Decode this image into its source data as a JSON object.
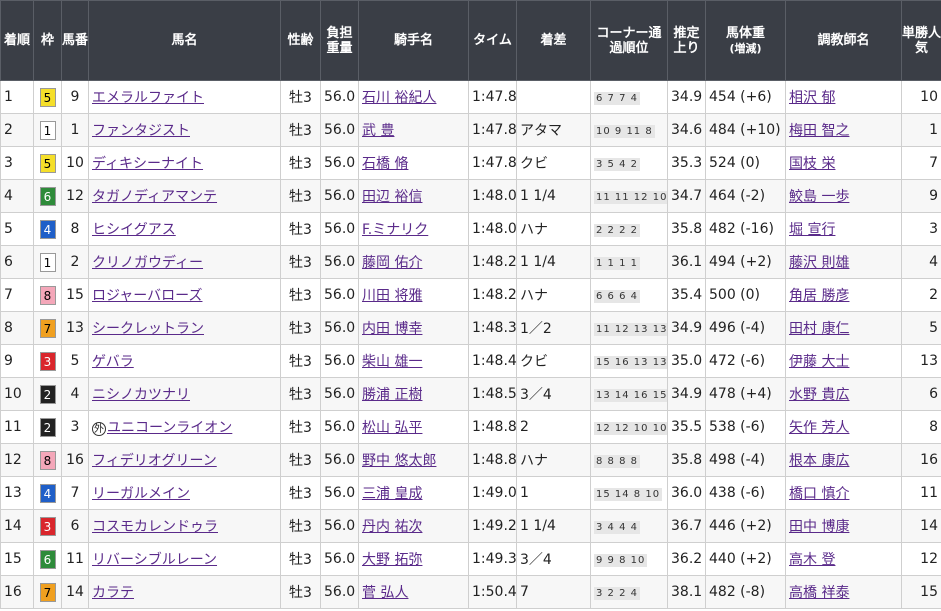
{
  "headers": {
    "rank": "着順",
    "waku": "枠",
    "num": "馬番",
    "name": "馬名",
    "sexage": "性齢",
    "weight": "負担重量",
    "jockey": "騎手名",
    "time": "タイム",
    "margin": "着差",
    "corner": "コーナー通過順位",
    "last": "推定上り",
    "bodywt": "馬体重",
    "bodywt_sub": "(増減)",
    "trainer": "調教師名",
    "pop": "単勝人気"
  },
  "colors": {
    "waku": {
      "1": "#ffffff",
      "2": "#222222",
      "3": "#d9262c",
      "4": "#1f5fc8",
      "5": "#f5df2a",
      "6": "#2e8b3a",
      "7": "#f0a020",
      "8": "#f4a7b9"
    },
    "waku_text": {
      "1": "#000000",
      "2": "#ffffff",
      "3": "#ffffff",
      "4": "#ffffff",
      "5": "#000000",
      "6": "#ffffff",
      "7": "#000000",
      "8": "#000000"
    }
  },
  "rows": [
    {
      "rank": "1",
      "waku": "5",
      "num": "9",
      "name": "エメラルファイト",
      "mark": "",
      "sexage": "牡3",
      "weight": "56.0",
      "jockey": "石川 裕紀人",
      "time": "1:47.8",
      "margin": "",
      "corner": "6 7 7 4",
      "last": "34.9",
      "bodywt": "454 (+6)",
      "trainer": "相沢 郁",
      "pop": "10"
    },
    {
      "rank": "2",
      "waku": "1",
      "num": "1",
      "name": "ファンタジスト",
      "mark": "",
      "sexage": "牡3",
      "weight": "56.0",
      "jockey": "武 豊",
      "time": "1:47.8",
      "margin": "アタマ",
      "corner": "10 9 11 8",
      "last": "34.6",
      "bodywt": "484 (+10)",
      "trainer": "梅田 智之",
      "pop": "1"
    },
    {
      "rank": "3",
      "waku": "5",
      "num": "10",
      "name": "ディキシーナイト",
      "mark": "",
      "sexage": "牡3",
      "weight": "56.0",
      "jockey": "石橋 脩",
      "time": "1:47.8",
      "margin": "クビ",
      "corner": "3 5 4 2",
      "last": "35.3",
      "bodywt": "524 (0)",
      "trainer": "国枝 栄",
      "pop": "7"
    },
    {
      "rank": "4",
      "waku": "6",
      "num": "12",
      "name": "タガノディアマンテ",
      "mark": "",
      "sexage": "牡3",
      "weight": "56.0",
      "jockey": "田辺 裕信",
      "time": "1:48.0",
      "margin": "1 1/4",
      "corner": "11 11 12 10",
      "last": "34.7",
      "bodywt": "464 (-2)",
      "trainer": "鮫島 一歩",
      "pop": "9"
    },
    {
      "rank": "5",
      "waku": "4",
      "num": "8",
      "name": "ヒシイグアス",
      "mark": "",
      "sexage": "牡3",
      "weight": "56.0",
      "jockey": "F.ミナリク",
      "time": "1:48.0",
      "margin": "ハナ",
      "corner": "2 2 2 2",
      "last": "35.8",
      "bodywt": "482 (-16)",
      "trainer": "堀 宣行",
      "pop": "3"
    },
    {
      "rank": "6",
      "waku": "1",
      "num": "2",
      "name": "クリノガウディー",
      "mark": "",
      "sexage": "牡3",
      "weight": "56.0",
      "jockey": "藤岡 佑介",
      "time": "1:48.2",
      "margin": "1 1/4",
      "corner": "1 1 1 1",
      "last": "36.1",
      "bodywt": "494 (+2)",
      "trainer": "藤沢 則雄",
      "pop": "4"
    },
    {
      "rank": "7",
      "waku": "8",
      "num": "15",
      "name": "ロジャーバローズ",
      "mark": "",
      "sexage": "牡3",
      "weight": "56.0",
      "jockey": "川田 将雅",
      "time": "1:48.2",
      "margin": "ハナ",
      "corner": "6 6 6 4",
      "last": "35.4",
      "bodywt": "500 (0)",
      "trainer": "角居 勝彦",
      "pop": "2"
    },
    {
      "rank": "8",
      "waku": "7",
      "num": "13",
      "name": "シークレットラン",
      "mark": "",
      "sexage": "牡3",
      "weight": "56.0",
      "jockey": "内田 博幸",
      "time": "1:48.3",
      "margin": "1／2",
      "corner": "11 12 13 13",
      "last": "34.9",
      "bodywt": "496 (-4)",
      "trainer": "田村 康仁",
      "pop": "5"
    },
    {
      "rank": "9",
      "waku": "3",
      "num": "5",
      "name": "ゲバラ",
      "mark": "",
      "sexage": "牡3",
      "weight": "56.0",
      "jockey": "柴山 雄一",
      "time": "1:48.4",
      "margin": "クビ",
      "corner": "15 16 13 13",
      "last": "35.0",
      "bodywt": "472 (-6)",
      "trainer": "伊藤 大士",
      "pop": "13"
    },
    {
      "rank": "10",
      "waku": "2",
      "num": "4",
      "name": "ニシノカツナリ",
      "mark": "",
      "sexage": "牡3",
      "weight": "56.0",
      "jockey": "勝浦 正樹",
      "time": "1:48.5",
      "margin": "3／4",
      "corner": "13 14 16 15",
      "last": "34.9",
      "bodywt": "478 (+4)",
      "trainer": "水野 貴広",
      "pop": "6"
    },
    {
      "rank": "11",
      "waku": "2",
      "num": "3",
      "name": "ユニコーンライオン",
      "mark": "外",
      "sexage": "牡3",
      "weight": "56.0",
      "jockey": "松山 弘平",
      "time": "1:48.8",
      "margin": "2",
      "corner": "12 12 10 10",
      "last": "35.5",
      "bodywt": "538 (-6)",
      "trainer": "矢作 芳人",
      "pop": "8"
    },
    {
      "rank": "12",
      "waku": "8",
      "num": "16",
      "name": "フィデリオグリーン",
      "mark": "",
      "sexage": "牡3",
      "weight": "56.0",
      "jockey": "野中 悠太郎",
      "time": "1:48.8",
      "margin": "ハナ",
      "corner": "8 8 8 8",
      "last": "35.8",
      "bodywt": "498 (-4)",
      "trainer": "根本 康広",
      "pop": "16"
    },
    {
      "rank": "13",
      "waku": "4",
      "num": "7",
      "name": "リーガルメイン",
      "mark": "",
      "sexage": "牡3",
      "weight": "56.0",
      "jockey": "三浦 皇成",
      "time": "1:49.0",
      "margin": "1",
      "corner": "15 14 8 10",
      "last": "36.0",
      "bodywt": "438 (-6)",
      "trainer": "橋口 慎介",
      "pop": "11"
    },
    {
      "rank": "14",
      "waku": "3",
      "num": "6",
      "name": "コスモカレンドゥラ",
      "mark": "",
      "sexage": "牡3",
      "weight": "56.0",
      "jockey": "丹内 祐次",
      "time": "1:49.2",
      "margin": "1 1/4",
      "corner": "3 4 4 4",
      "last": "36.7",
      "bodywt": "446 (+2)",
      "trainer": "田中 博康",
      "pop": "14"
    },
    {
      "rank": "15",
      "waku": "6",
      "num": "11",
      "name": "リバーシブルレーン",
      "mark": "",
      "sexage": "牡3",
      "weight": "56.0",
      "jockey": "大野 拓弥",
      "time": "1:49.3",
      "margin": "3／4",
      "corner": "9 9 8 10",
      "last": "36.2",
      "bodywt": "440 (+2)",
      "trainer": "高木 登",
      "pop": "12"
    },
    {
      "rank": "16",
      "waku": "7",
      "num": "14",
      "name": "カラテ",
      "mark": "",
      "sexage": "牡3",
      "weight": "56.0",
      "jockey": "菅 弘人",
      "time": "1:50.4",
      "margin": "7",
      "corner": "3 2 2 4",
      "last": "38.1",
      "bodywt": "482 (-8)",
      "trainer": "高橋 祥泰",
      "pop": "15"
    }
  ]
}
